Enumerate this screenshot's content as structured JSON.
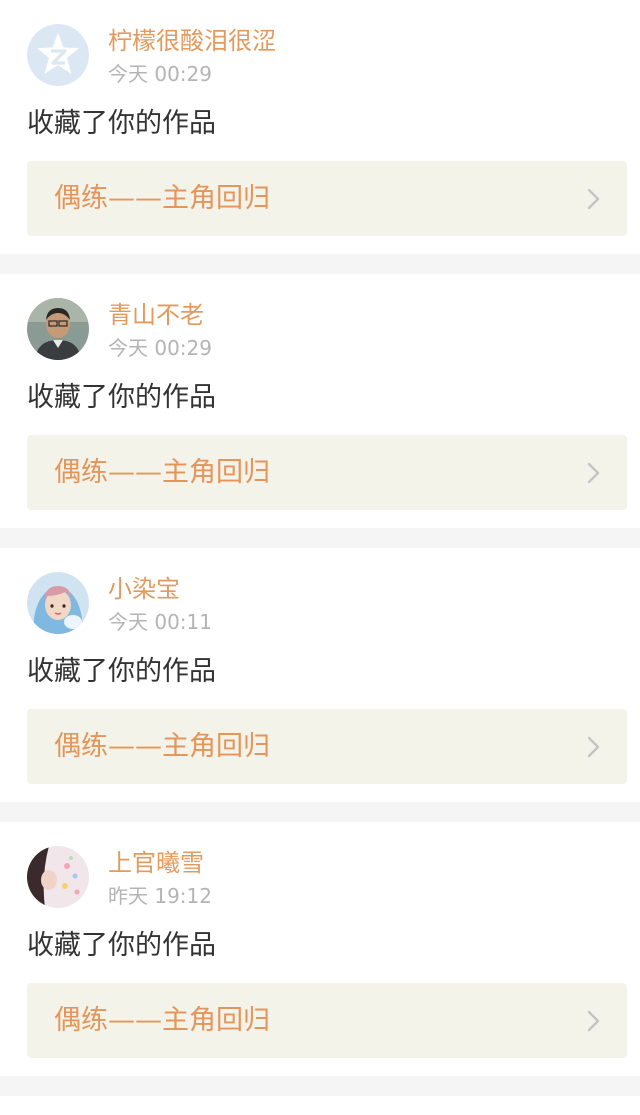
{
  "notifications": [
    {
      "username": "柠檬很酸泪很涩",
      "time": "今天 00:29",
      "action": "收藏了你的作品",
      "work_title": "偶练——主角回归",
      "avatar_icon": "qq-default-avatar-icon"
    },
    {
      "username": "青山不老",
      "time": "今天 00:29",
      "action": "收藏了你的作品",
      "work_title": "偶练——主角回归",
      "avatar_icon": "user-photo-avatar"
    },
    {
      "username": "小染宝",
      "time": "今天 00:11",
      "action": "收藏了你的作品",
      "work_title": "偶练——主角回归",
      "avatar_icon": "user-photo-avatar"
    },
    {
      "username": "上官曦雪",
      "time": "昨天 19:12",
      "action": "收藏了你的作品",
      "work_title": "偶练——主角回归",
      "avatar_icon": "user-photo-avatar"
    }
  ],
  "colors": {
    "username": "#e39a5c",
    "time": "#b4b4b4",
    "action_text": "#333333",
    "link_bg": "#f4f3ea",
    "link_text": "#e3955a",
    "page_bg": "#f5f5f5"
  },
  "icons": {
    "link_arrow": "chevron-right-icon"
  }
}
